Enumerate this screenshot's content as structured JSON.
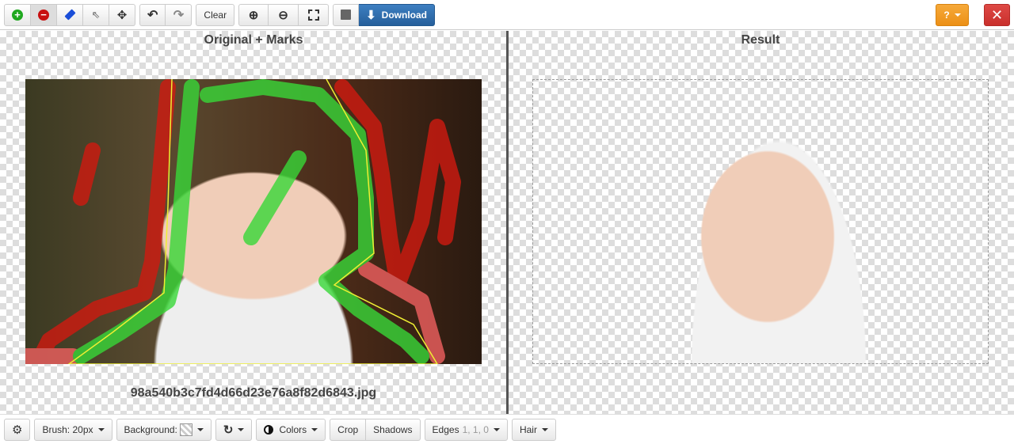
{
  "toolbar": {
    "clear": "Clear",
    "download": "Download",
    "help": "?"
  },
  "panels": {
    "left_title": "Original + Marks",
    "right_title": "Result",
    "filename": "98a540b3c7fd4d66d23e76a8f82d6843.jpg"
  },
  "bottom": {
    "brush": "Brush: 20px",
    "background": "Background:",
    "colors": "Colors",
    "crop": "Crop",
    "shadows": "Shadows",
    "edges": "Edges",
    "edges_values": "1, 1, 0",
    "hair": "Hair"
  },
  "colors": {
    "keep": "#22aa22",
    "remove": "#cc1111",
    "primary": "#2a6aad",
    "help": "#f0a030",
    "close": "#d43f3a"
  }
}
